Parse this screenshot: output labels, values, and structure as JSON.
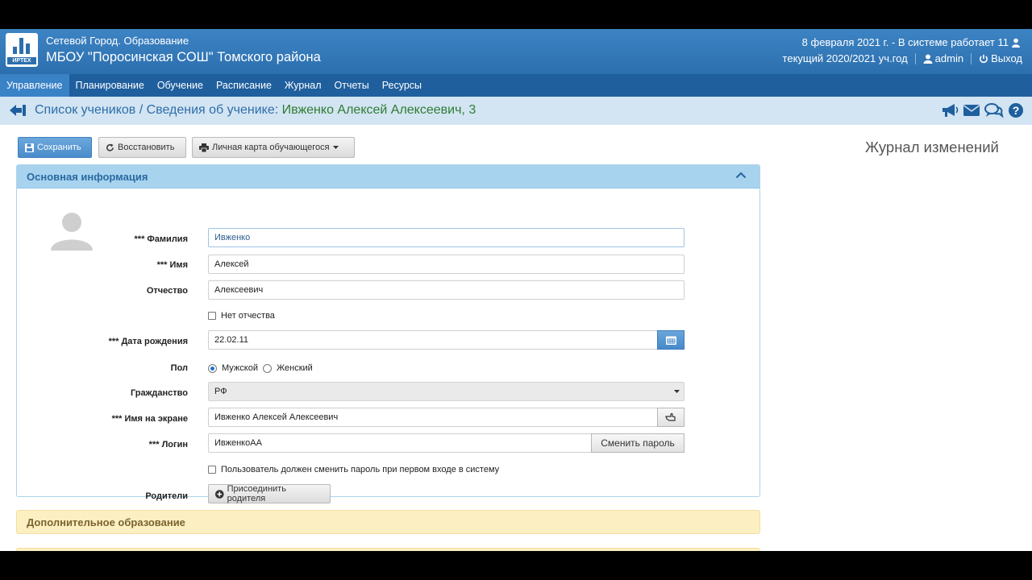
{
  "header": {
    "app_subtitle": "Сетевой Город. Образование",
    "school_title": "МБОУ \"Поросинская СОШ\" Томского района",
    "logo_text": "ИРТЕХ",
    "date_status": "8 февраля 2021 г. - В системе работает 11",
    "school_year": "текущий 2020/2021 уч.год",
    "user": "admin",
    "logout": "Выход"
  },
  "nav": {
    "items": [
      "Управление",
      "Планирование",
      "Обучение",
      "Расписание",
      "Журнал",
      "Отчеты",
      "Ресурсы"
    ],
    "active_index": 0
  },
  "breadcrumb": {
    "path": "Список учеников / Сведения об ученике: ",
    "student": "Ивженко Алексей Алексеевич, 3"
  },
  "toolbar": {
    "save": "Сохранить",
    "restore": "Восстановить",
    "personal_card": "Личная карта обучающегося"
  },
  "side": {
    "journal_title": "Журнал изменений"
  },
  "main_panel": {
    "title": "Основная информация",
    "labels": {
      "last_name": "*** Фамилия",
      "first_name": "*** Имя",
      "patronymic": "Отчество",
      "birth_date": "*** Дата рождения",
      "gender": "Пол",
      "citizenship": "Гражданство",
      "display_name": "*** Имя на экране",
      "login": "*** Логин",
      "parents": "Родители"
    },
    "values": {
      "last_name": "Ивженко",
      "first_name": "Алексей",
      "patronymic": "Алексеевич",
      "birth_date": "22.02.11",
      "citizenship": "РФ",
      "display_name": "Ивженко Алексей Алексеевич",
      "login": "ИвженкоАА"
    },
    "no_patronymic": "Нет отчества",
    "gender_options": [
      "Мужской",
      "Женский"
    ],
    "gender_selected": "Мужской",
    "change_password": "Сменить пароль",
    "must_change_password": "Пользователь должен сменить пароль при первом входе в систему",
    "attach_parent": "Присоединить родителя"
  },
  "extra_panel": {
    "title": "Дополнительное образование"
  },
  "colors": {
    "header": "#2c6fae",
    "nav": "#1f5f9e",
    "accent_green": "#2e7d32",
    "panel_head": "#a8d3ef",
    "extra_panel": "#fcf0c2"
  }
}
